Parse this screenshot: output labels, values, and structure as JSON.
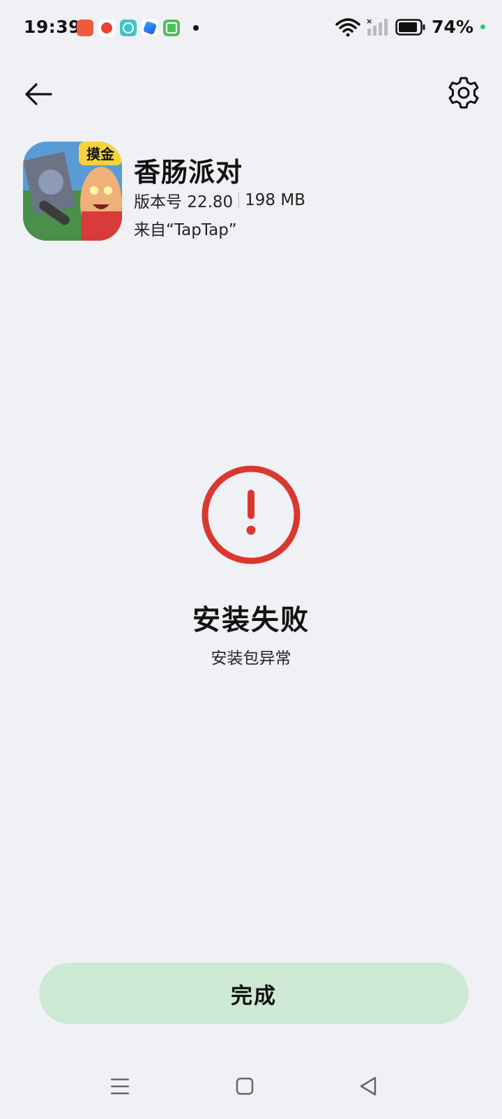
{
  "status_bar": {
    "time": "19:39",
    "battery_percent": "74%",
    "notification_icons": [
      "app-icon-red",
      "app-icon-orange",
      "app-icon-teal",
      "app-icon-blue",
      "app-icon-green"
    ]
  },
  "header": {
    "back_icon": "back-arrow-icon",
    "settings_icon": "gear-icon"
  },
  "app": {
    "name": "香肠派对",
    "version_label": "版本号 22.80",
    "size": "198 MB",
    "source": "来自“TapTap”",
    "icon_badge": "摸金"
  },
  "result": {
    "title": "安装失败",
    "reason": "安装包异常",
    "icon": "error-exclamation-icon",
    "color": "#d9382f"
  },
  "actions": {
    "done_label": "完成"
  },
  "nav_bar": {
    "menu_icon": "menu-icon",
    "home_icon": "home-icon",
    "back_icon": "back-triangle-icon"
  }
}
